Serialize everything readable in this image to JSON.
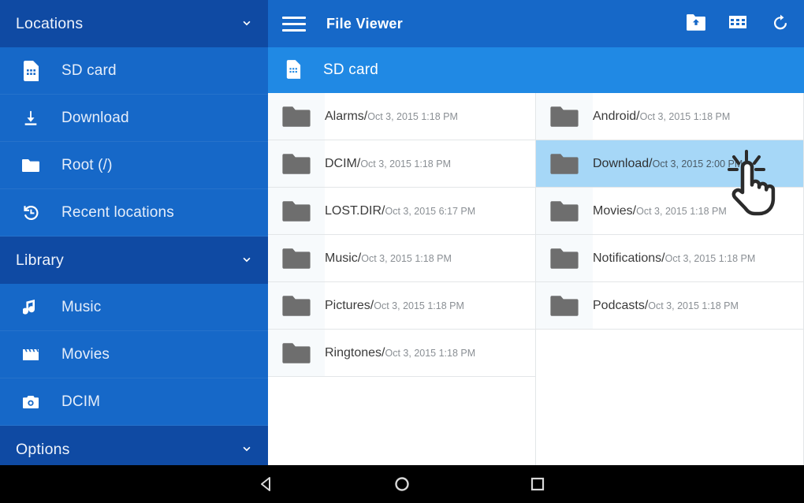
{
  "app": {
    "title": "File Viewer",
    "menu_icon": "hamburger-menu-icon"
  },
  "toolbar": {
    "actions": [
      {
        "name": "create-folder-icon",
        "label": "Create folder"
      },
      {
        "name": "grid-view-icon",
        "label": "Grid view"
      },
      {
        "name": "refresh-icon",
        "label": "Refresh"
      }
    ]
  },
  "breadcrumb": {
    "icon": "sd-card-icon",
    "label": "SD card"
  },
  "sidebar": {
    "sections": [
      {
        "title": "Locations",
        "chevron": "chevron-down-icon",
        "items": [
          {
            "icon": "sd-card-icon",
            "label": "SD card"
          },
          {
            "icon": "download-icon",
            "label": "Download"
          },
          {
            "icon": "folder-icon",
            "label": "Root (/)"
          },
          {
            "icon": "history-icon",
            "label": "Recent locations"
          }
        ]
      },
      {
        "title": "Library",
        "chevron": "chevron-down-icon",
        "items": [
          {
            "icon": "music-note-icon",
            "label": "Music"
          },
          {
            "icon": "movie-clapper-icon",
            "label": "Movies"
          },
          {
            "icon": "camera-icon",
            "label": "DCIM"
          }
        ]
      },
      {
        "title": "Options",
        "chevron": "chevron-down-icon",
        "items": []
      }
    ]
  },
  "files": {
    "left_column": [
      {
        "name": "Alarms/",
        "date": "Oct 3, 2015 1:18 PM",
        "selected": false
      },
      {
        "name": "DCIM/",
        "date": "Oct 3, 2015 1:18 PM",
        "selected": false
      },
      {
        "name": "LOST.DIR/",
        "date": "Oct 3, 2015 6:17 PM",
        "selected": false
      },
      {
        "name": "Music/",
        "date": "Oct 3, 2015 1:18 PM",
        "selected": false
      },
      {
        "name": "Pictures/",
        "date": "Oct 3, 2015 1:18 PM",
        "selected": false
      },
      {
        "name": "Ringtones/",
        "date": "Oct 3, 2015 1:18 PM",
        "selected": false
      }
    ],
    "right_column": [
      {
        "name": "Android/",
        "date": "Oct 3, 2015 1:18 PM",
        "selected": false
      },
      {
        "name": "Download/",
        "date": "Oct 3, 2015 2:00 PM",
        "selected": true
      },
      {
        "name": "Movies/",
        "date": "Oct 3, 2015 1:18 PM",
        "selected": false
      },
      {
        "name": "Notifications/",
        "date": "Oct 3, 2015 1:18 PM",
        "selected": false
      },
      {
        "name": "Podcasts/",
        "date": "Oct 3, 2015 1:18 PM",
        "selected": false
      }
    ]
  },
  "cursor": {
    "icon": "tap-hand-cursor"
  },
  "navbar": {
    "buttons": [
      {
        "name": "back-button",
        "icon": "triangle-back-icon"
      },
      {
        "name": "home-button",
        "icon": "circle-home-icon"
      },
      {
        "name": "recents-button",
        "icon": "square-recents-icon"
      }
    ]
  },
  "colors": {
    "appbar": "#1668c8",
    "sidebar_header": "#0f4aa3",
    "sidebar_item": "#1668c8",
    "breadcrumb": "#2089e4",
    "selected_row": "#a6d7f7",
    "folder_icon": "#6e6e6e",
    "navbar": "#000000"
  }
}
